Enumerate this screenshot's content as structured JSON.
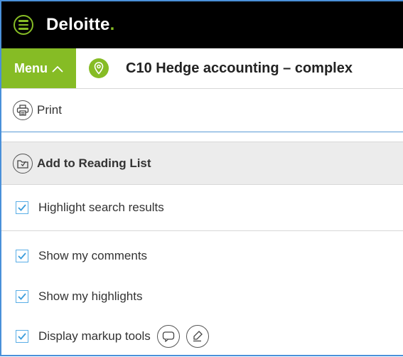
{
  "header": {
    "brand_name": "Deloitte",
    "brand_dot": ".",
    "brand_color": "#86bc25"
  },
  "nav": {
    "menu_label": "Menu",
    "document_title": "C10 Hedge accounting – complex"
  },
  "actions": {
    "print_label": "Print",
    "reading_list_label": "Add to Reading List"
  },
  "options": [
    {
      "label": "Highlight search results",
      "checked": true
    },
    {
      "label": "Show my comments",
      "checked": true
    },
    {
      "label": "Show my highlights",
      "checked": true
    },
    {
      "label": "Display markup tools",
      "checked": true
    }
  ],
  "icons": {
    "menu": "hamburger-icon",
    "location": "location-pin-icon",
    "print": "printer-icon",
    "reading_list": "reading-list-icon",
    "comment_tool": "comment-icon",
    "highlight_tool": "highlighter-icon"
  }
}
